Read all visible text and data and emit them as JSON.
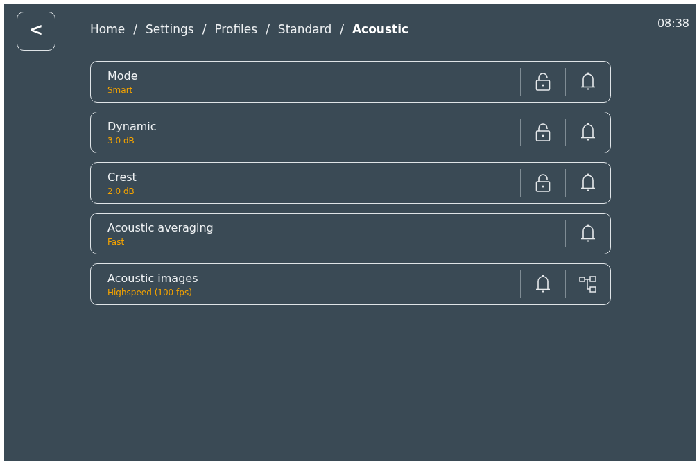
{
  "header": {
    "back_button": {
      "label": "<"
    },
    "breadcrumb": [
      {
        "label": "Home",
        "current": false,
        "separator": "/"
      },
      {
        "label": "Settings",
        "current": false,
        "separator": "/"
      },
      {
        "label": "Profiles",
        "current": false,
        "separator": "/"
      },
      {
        "label": "Standard",
        "current": false,
        "separator": "/"
      },
      {
        "label": "Acoustic",
        "current": true
      }
    ],
    "clock": "08:38"
  },
  "settings": [
    {
      "title": "Mode",
      "value": "Smart",
      "actions": [
        {
          "kind": "lock"
        },
        {
          "kind": "bell"
        }
      ]
    },
    {
      "title": "Dynamic",
      "value": "3.0 dB",
      "actions": [
        {
          "kind": "lock"
        },
        {
          "kind": "bell"
        }
      ]
    },
    {
      "title": "Crest",
      "value": "2.0 dB",
      "actions": [
        {
          "kind": "lock"
        },
        {
          "kind": "bell"
        }
      ]
    },
    {
      "title": "Acoustic averaging",
      "value": "Fast",
      "actions": [
        {
          "kind": "bell"
        }
      ]
    },
    {
      "title": "Acoustic images",
      "value": "Highspeed (100 fps)",
      "actions": [
        {
          "kind": "bell"
        },
        {
          "kind": "tree"
        }
      ]
    }
  ]
}
